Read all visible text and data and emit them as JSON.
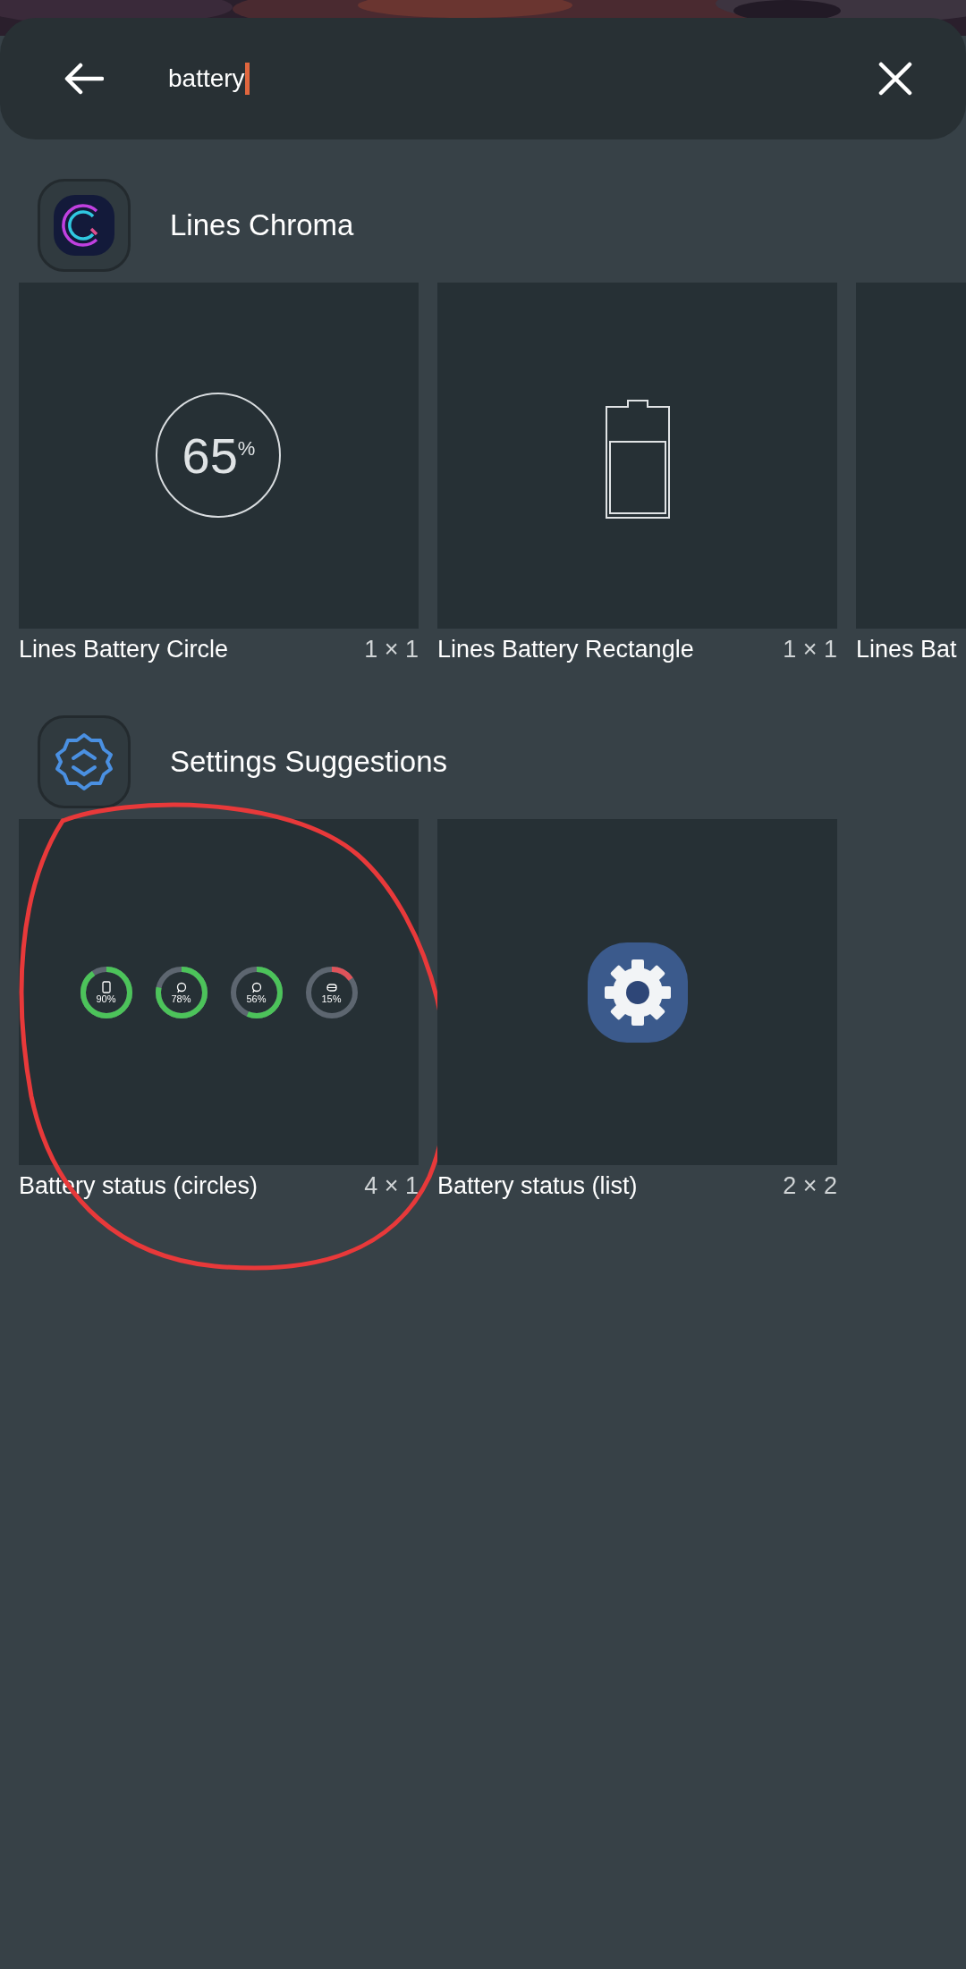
{
  "search": {
    "value": "battery"
  },
  "sections": [
    {
      "app": "Lines Chroma",
      "kind": "chroma",
      "widgets": [
        {
          "name": "Lines Battery Circle",
          "size": "1 × 1",
          "preview": {
            "kind": "circle-battery",
            "reading": "65$^{%}$"
          },
          "circled": false
        },
        {
          "name": "Lines Battery Rectangle",
          "size": "1 × 1",
          "preview": {
            "kind": "rect-battery"
          },
          "circled": false
        },
        {
          "name": "Lines Bat",
          "preview": {
            "kind": "blank"
          },
          "circled": false
        }
      ]
    },
    {
      "app": "Settings Suggestions",
      "kind": "settings",
      "widgets": [
        {
          "name": "Battery status (circles)",
          "size": "4 × 1",
          "circled": true,
          "preview": {
            "kind": "battery-rings",
            "rings": [
              {
                "kind": "phone",
                "level": 0.9,
                "color": "#4cc35a",
                "reading": "90%"
              },
              {
                "kind": "earbud",
                "level": 0.78,
                "color": "#4cc35a",
                "reading": "78%"
              },
              {
                "kind": "earbud",
                "level": 0.56,
                "color": "#4cc35a",
                "reading": "56%"
              },
              {
                "kind": "case",
                "level": 0.15,
                "color": "#e0535a",
                "reading": "15%"
              }
            ]
          }
        },
        {
          "name": "Battery status (list)",
          "size": "2 × 2",
          "preview": {
            "kind": "gear-app"
          },
          "circled": false
        }
      ]
    }
  ]
}
